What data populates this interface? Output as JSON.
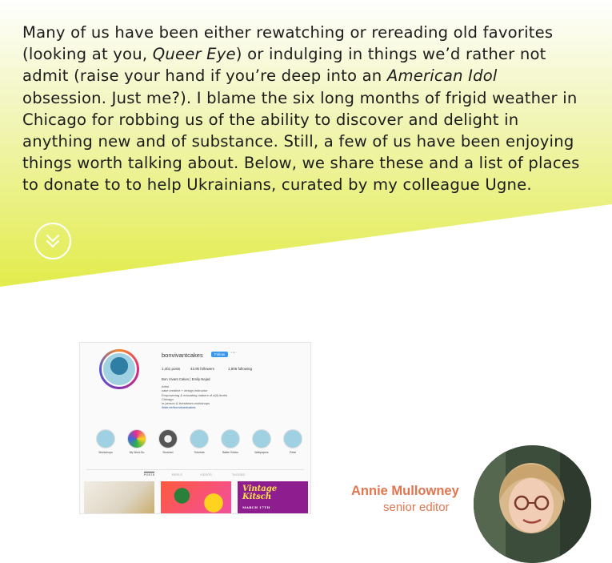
{
  "intro": {
    "t1": "Many of us have been either rewatching or rereading old favorites (looking at you, ",
    "show": "Queer Eye",
    "t2": ") or indulging in things we’d rather not admit (raise your hand if you’re deep into an ",
    "idol": "American Idol",
    "t3": " obsession. Just me?). I blame the six long months of frigid weather in Chicago for robbing us of the ability to discover and delight in anything new and of substance. Still, a few of us have been enjoying things worth talking about. Below, we share these and a list of places to donate to to help Ukrainians, curated by my colleague Ugne."
  },
  "scroll_button": {
    "icon": "double-chevron-down-icon"
  },
  "instagram": {
    "username": "bonvivantcakes",
    "follow_label": "Follow",
    "more": "···",
    "posts": "1,401 posts",
    "followers": "43.8k followers",
    "following": "1,906 following",
    "display_name": "Bon Vivant Cakes | Emily Nejad",
    "bio": [
      "Artist",
      "cake creative + design instructor",
      "Empowering & educating makers of a(ll) levels",
      "Chicago",
      "in-person & livestream workshops"
    ],
    "link": "linktr.ee/bonvivantcakes",
    "highlights": [
      {
        "label": "Workshops",
        "color": "#9fd1e3"
      },
      {
        "label": "My Work Bc",
        "color": "#ec2f8a"
      },
      {
        "label": "Brushed",
        "color": "#555555"
      },
      {
        "label": "Tutorials",
        "color": "#9fd1e3"
      },
      {
        "label": "Batter Bricks",
        "color": "#9fd1e3"
      },
      {
        "label": "Wallpapers",
        "color": "#9fd1e3"
      },
      {
        "label": "Petal",
        "color": "#9fd1e3"
      }
    ],
    "tabs": [
      "POSTS",
      "REELS",
      "VIDEOS",
      "TAGGED"
    ],
    "thumb3_title": "Vintage Kitsch",
    "thumb3_sub": "MARCH 17TH"
  },
  "author": {
    "name": "Annie Mullowney",
    "role": "senior editor"
  }
}
